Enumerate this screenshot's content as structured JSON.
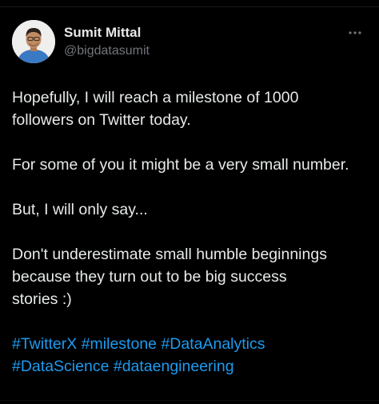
{
  "tweet": {
    "author": {
      "display_name": "Sumit Mittal",
      "handle": "@bigdatasumit",
      "avatar_icon": "profile-photo-avatar"
    },
    "more_icon": "more-dots-icon",
    "paragraphs": [
      [
        "Hopefully, I will reach a milestone of 1000",
        "followers on Twitter today."
      ],
      [
        "For some of you it might be a very small number."
      ],
      [
        "But, I will only say..."
      ],
      [
        "Don't underestimate small humble beginnings",
        "because they turn out to be big success",
        "stories :)"
      ]
    ],
    "hashtags": [
      [
        "#TwitterX",
        "#milestone",
        "#DataAnalytics"
      ],
      [
        "#DataScience",
        "#dataengineering"
      ]
    ]
  },
  "colors": {
    "background": "#000000",
    "text": "#e7e9ea",
    "secondary_text": "#71767b",
    "link": "#1d9bf0"
  }
}
